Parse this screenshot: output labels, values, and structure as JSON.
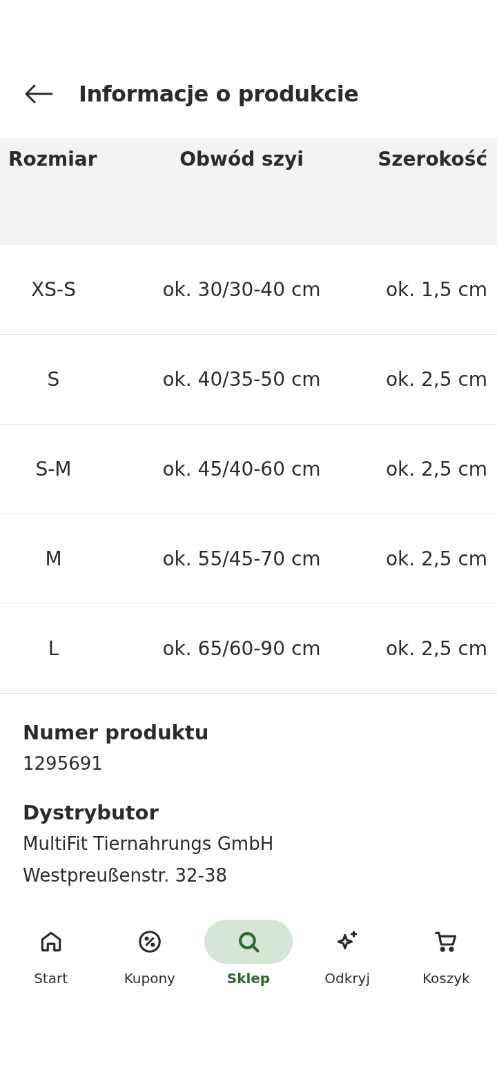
{
  "header": {
    "title": "Informacje o produkcie"
  },
  "table": {
    "columns": [
      "Rozmiar",
      "Obwód szyi",
      "Szerokość"
    ],
    "rows": [
      [
        "XS-S",
        "ok. 30/30-40 cm",
        "ok. 1,5 cm"
      ],
      [
        "S",
        "ok. 40/35-50 cm",
        "ok. 2,5 cm"
      ],
      [
        "S-M",
        "ok. 45/40-60 cm",
        "ok. 2,5 cm"
      ],
      [
        "M",
        "ok. 55/45-70 cm",
        "ok. 2,5 cm"
      ],
      [
        "L",
        "ok. 65/60-90 cm",
        "ok. 2,5 cm"
      ]
    ]
  },
  "details": [
    {
      "label": "Numer produktu",
      "lines": [
        "1295691"
      ]
    },
    {
      "label": "Dystrybutor",
      "lines": [
        "MultiFit Tiernahrungs GmbH",
        "Westpreußenstr. 32-38"
      ]
    }
  ],
  "nav": [
    {
      "kind": "home",
      "label": "Start",
      "selected": false
    },
    {
      "kind": "coupon",
      "label": "Kupony",
      "selected": false
    },
    {
      "kind": "search",
      "label": "Sklep",
      "selected": true
    },
    {
      "kind": "sparkle",
      "label": "Odkryj",
      "selected": false
    },
    {
      "kind": "cart",
      "label": "Koszyk",
      "selected": false
    }
  ]
}
